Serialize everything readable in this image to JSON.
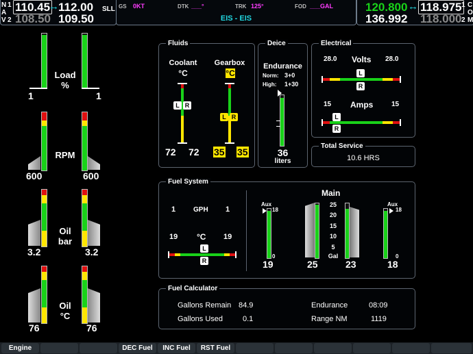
{
  "topbar": {
    "nav_label_left": "N",
    "nav_label_left2": "A",
    "nav_label_left3": "V",
    "nav1_num": "1",
    "nav2_num": "2",
    "nav1_active": "110.45",
    "nav1_standby": "112.00",
    "nav2_active": "108.50",
    "nav2_standby": "109.50",
    "nav_id": "SLL",
    "swap_arrow": "↔",
    "gs_label": "GS",
    "gs_value": "0KT",
    "dtk_label": "DTK",
    "dtk_value": "___°",
    "trk_label": "TRK",
    "trk_value": "125°",
    "fod_label": "FOD",
    "fod_value": "___GAL",
    "page_title": "EIS - EIS",
    "com1_active": "120.800",
    "com1_standby": "118.975",
    "com2_active": "136.992",
    "com2_standby": "118.000",
    "com_label1": "C",
    "com_label2": "O",
    "com_label3": "M",
    "com1_num": "1",
    "com2_num": "2"
  },
  "left_gauges": {
    "load": {
      "label_line1": "Load",
      "label_line2": "%",
      "left_value": "1",
      "right_value": "1"
    },
    "rpm": {
      "label": "RPM",
      "left_value": "600",
      "right_value": "600"
    },
    "oil_bar": {
      "label_line1": "Oil",
      "label_line2": "bar",
      "left_value": "3.2",
      "right_value": "3.2"
    },
    "oil_c": {
      "label_line1": "Oil",
      "label_line2": "°C",
      "left_value": "76",
      "right_value": "76"
    }
  },
  "fluids": {
    "title": "Fluids",
    "coolant_label": "Coolant",
    "coolant_unit": "°C",
    "gearbox_label": "Gearbox",
    "gearbox_unit": "°C",
    "coolant_left": "72",
    "coolant_right": "72",
    "gearbox_left": "35",
    "gearbox_right": "35",
    "ptr_l": "L",
    "ptr_r": "R"
  },
  "deice": {
    "title": "Deice",
    "endurance_label": "Endurance",
    "norm_label": "Norm:",
    "norm_value": "3+0",
    "high_label": "High:",
    "high_value": "1+30",
    "qty_value": "36",
    "qty_unit": "liters"
  },
  "electrical": {
    "title": "Electrical",
    "volts_label": "Volts",
    "volts_left": "28.0",
    "volts_right": "28.0",
    "amps_label": "Amps",
    "amps_left": "15",
    "amps_right": "15",
    "ptr_l": "L",
    "ptr_r": "R"
  },
  "total_service": {
    "title": "Total Service",
    "value": "10.6 HRS"
  },
  "fuel_system": {
    "title": "Fuel System",
    "gph_left": "1",
    "gph_label": "GPH",
    "gph_right": "1",
    "temp_left": "19",
    "temp_unit": "°C",
    "temp_right": "19",
    "main_label": "Main",
    "aux_label": "Aux",
    "aux_top": "18",
    "aux_bottom": "0",
    "scale": [
      "25",
      "20",
      "15",
      "10",
      "5",
      "Gal"
    ],
    "aux_left_value": "19",
    "main_left_value": "25",
    "main_right_value": "23",
    "aux_right_value": "18",
    "ptr_l": "L",
    "ptr_r": "R"
  },
  "fuel_calc": {
    "title": "Fuel Calculator",
    "gallons_remain_label": "Gallons Remain",
    "gallons_remain_value": "84.9",
    "gallons_used_label": "Gallons Used",
    "gallons_used_value": "0.1",
    "endurance_label": "Endurance",
    "endurance_value": "08:09",
    "range_label": "Range NM",
    "range_value": "1119"
  },
  "softkeys": [
    "Engine",
    "",
    "",
    "DEC Fuel",
    "INC Fuel",
    "RST Fuel",
    "",
    "",
    "",
    "",
    "",
    ""
  ],
  "colors": {
    "green": "#19d219",
    "yellow": "#ffe600",
    "red": "#e01010",
    "cyan": "#21d6e0",
    "magenta": "#ff3cff"
  }
}
